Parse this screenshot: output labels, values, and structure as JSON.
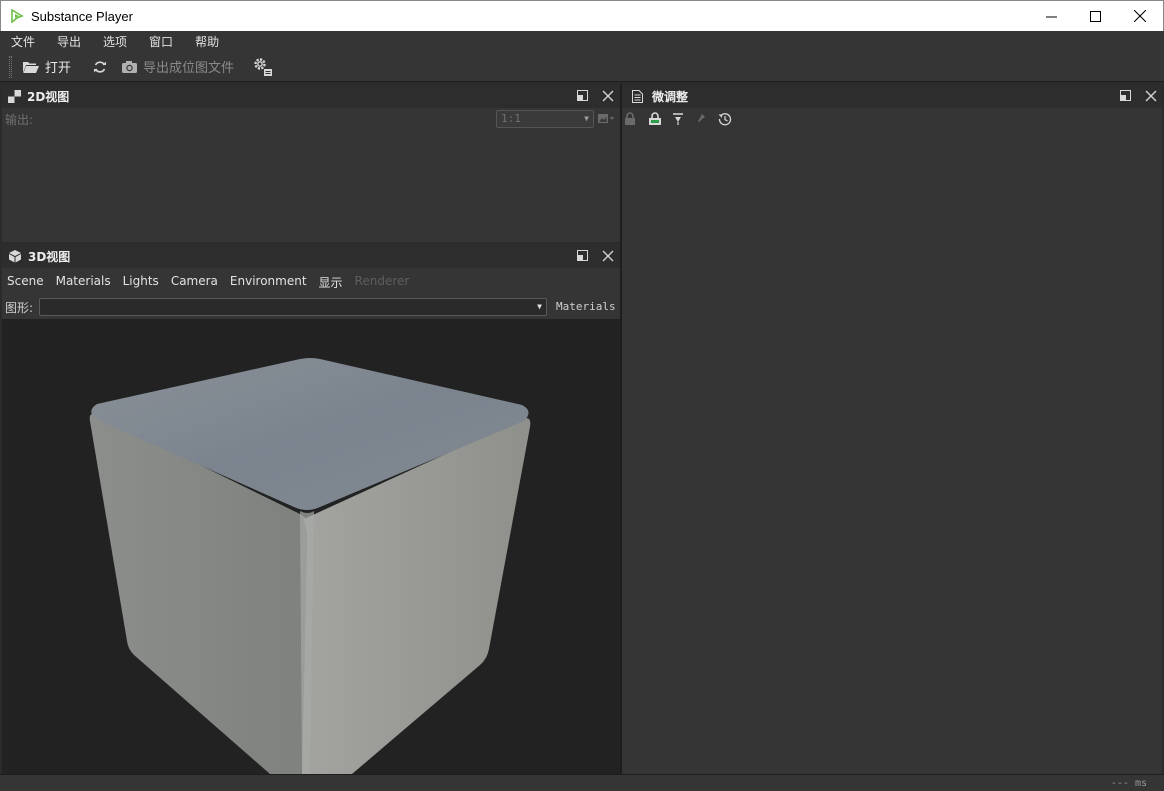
{
  "window": {
    "title": "Substance Player",
    "brand_color": "#6dbf4b"
  },
  "menu": [
    "文件",
    "导出",
    "选项",
    "窗口",
    "帮助"
  ],
  "toolbar": {
    "open_label": "打开",
    "export_bitmap_label": "导出成位图文件"
  },
  "panel_2d": {
    "title": "2D视图",
    "output_label": "输出:",
    "zoom_value": "1:1"
  },
  "panel_3d": {
    "title": "3D视图",
    "tabs": [
      "Scene",
      "Materials",
      "Lights",
      "Camera",
      "Environment",
      "显示"
    ],
    "renderer_tab": "Renderer",
    "shape_label": "图形:",
    "shape_value": "",
    "materials_button": "Materials"
  },
  "panel_tweak": {
    "title": "微调整"
  },
  "status": {
    "timing": "--- ms"
  }
}
